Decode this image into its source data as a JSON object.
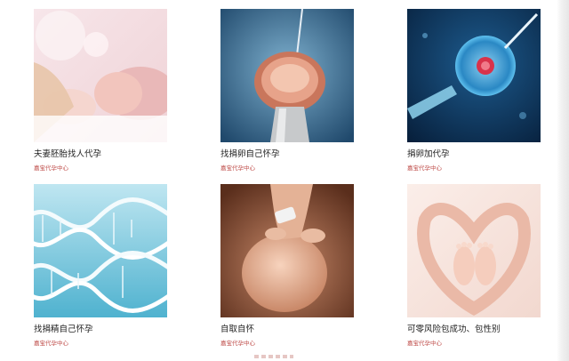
{
  "cards": [
    {
      "title": "夫妻胚胎找人代孕",
      "subtitle": "嘉宝代孕中心"
    },
    {
      "title": "找捐卵自己怀孕",
      "subtitle": "嘉宝代孕中心"
    },
    {
      "title": "捐卵加代孕",
      "subtitle": "嘉宝代孕中心"
    },
    {
      "title": "找捐精自己怀孕",
      "subtitle": "嘉宝代孕中心"
    },
    {
      "title": "自取自怀",
      "subtitle": "嘉宝代孕中心"
    },
    {
      "title": "可零风险包成功、包性别",
      "subtitle": "嘉宝代孕中心"
    }
  ]
}
